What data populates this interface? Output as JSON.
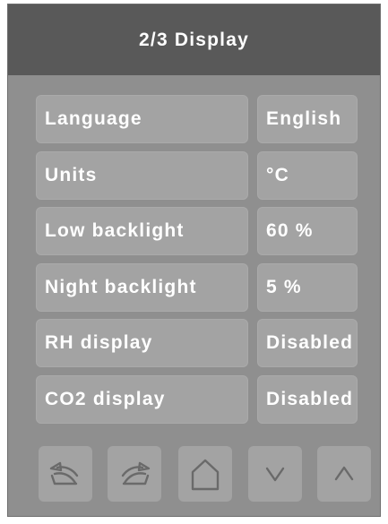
{
  "header": {
    "title": "2/3 Display"
  },
  "settings": [
    {
      "label": "Language",
      "value": "English"
    },
    {
      "label": "Units",
      "value": "°C"
    },
    {
      "label": "Low backlight",
      "value": "60 %"
    },
    {
      "label": "Night backlight",
      "value": "5 %"
    },
    {
      "label": "RH display",
      "value": "Disabled"
    },
    {
      "label": "CO2 display",
      "value": "Disabled"
    }
  ],
  "nav": [
    {
      "icon": "undo-icon"
    },
    {
      "icon": "redo-icon"
    },
    {
      "icon": "home-icon"
    },
    {
      "icon": "chevron-down-icon"
    },
    {
      "icon": "chevron-up-icon"
    }
  ],
  "colors": {
    "panel": "#8f8f8f",
    "header": "#595959",
    "button": "#a3a3a3",
    "text": "#ffffff",
    "icon": "#6a6a6a"
  }
}
